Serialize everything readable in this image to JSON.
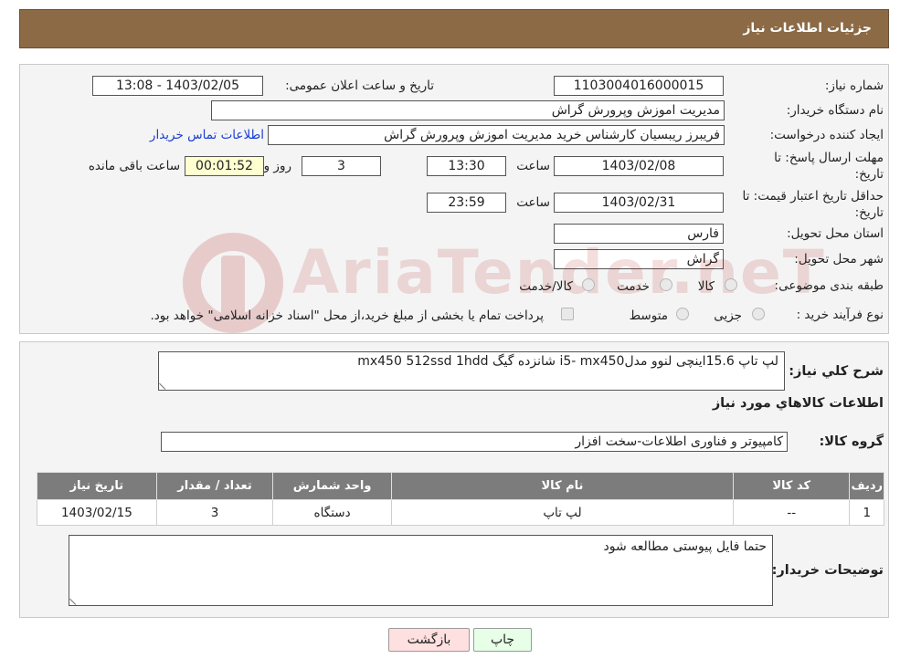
{
  "header": {
    "title": "جزئیات اطلاعات نیاز"
  },
  "form": {
    "need_number": {
      "label": "شماره نیاز:",
      "value": "1103004016000015"
    },
    "announce_datetime": {
      "label": "تاریخ و ساعت اعلان عمومی:",
      "value": "1403/02/05 - 13:08"
    },
    "buyer_org": {
      "label": "نام دستگاه خریدار:",
      "value": "مدیریت اموزش وپرورش گراش"
    },
    "requester": {
      "label": "ایجاد کننده درخواست:",
      "value": "فریبرز ریبسیان کارشناس خرید مدیریت اموزش وپرورش گراش",
      "contact_link": "اطلاعات تماس خریدار"
    },
    "reply_deadline": {
      "label_line1": "مهلت ارسال پاسخ: تا",
      "label_line2": "تاریخ:",
      "date": "1403/02/08",
      "time_label": "ساعت",
      "time": "13:30",
      "days": "3",
      "days_label": "روز و",
      "remaining": "00:01:52",
      "remaining_label": "ساعت باقی مانده"
    },
    "price_validity": {
      "label_line1": "حداقل تاریخ اعتبار قیمت: تا",
      "label_line2": "تاریخ:",
      "date": "1403/02/31",
      "time_label": "ساعت",
      "time": "23:59"
    },
    "province": {
      "label": "استان محل تحویل:",
      "value": "فارس"
    },
    "city": {
      "label": "شهر محل تحویل:",
      "value": "گراش"
    },
    "category": {
      "label": "طبقه بندی موضوعی:",
      "options": [
        "کالا",
        "خدمت",
        "کالا/خدمت"
      ]
    },
    "purchase_process": {
      "label": "نوع فرآیند خرید :",
      "options": [
        "جزیی",
        "متوسط"
      ],
      "note": "پرداخت تمام یا بخشی از مبلغ خرید،از محل \"اسناد خزانه اسلامی\" خواهد بود."
    }
  },
  "description": {
    "label": "شرح کلي نياز:",
    "value": "لپ تاپ 15.6اینچی لنوو مدلi5- mx450  شانزده گیگ mx450  512ssd    1hdd"
  },
  "goods_section": {
    "title": "اطلاعات کالاهاي مورد نياز",
    "group_label": "گروه کالا:",
    "group_value": "کامپیوتر و فناوری اطلاعات-سخت افزار"
  },
  "table": {
    "headers": [
      "رديف",
      "کد کالا",
      "نام کالا",
      "واحد شمارش",
      "تعداد / مقدار",
      "تاریخ نیاز"
    ],
    "rows": [
      [
        "1",
        "--",
        "لپ تاپ",
        "دستگاه",
        "3",
        "1403/02/15"
      ]
    ]
  },
  "buyer_notes": {
    "label": "توضیحات خریدار:",
    "value": "حتما فایل پیوستی مطالعه شود"
  },
  "buttons": {
    "print": "چاپ",
    "back": "بازگشت"
  },
  "watermark": {
    "text": "AriaTender.neT"
  },
  "colors": {
    "header_bg": "#8b6a45",
    "link": "#1a3ed6",
    "back_button_bg": "#ffe0e0",
    "print_button_bg": "#e6ffe6",
    "table_header_bg": "#7c7c7c"
  }
}
